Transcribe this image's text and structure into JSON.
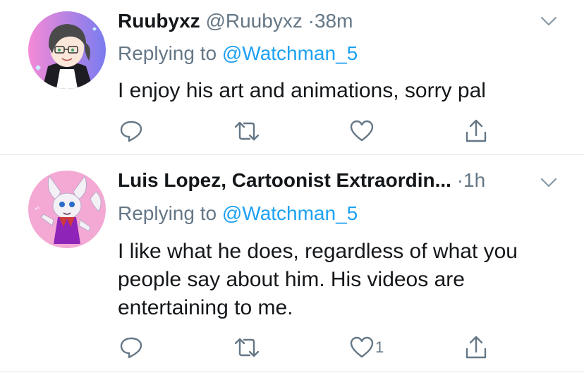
{
  "tweets": [
    {
      "display_name": "Ruubyxz",
      "handle": "@Ruubyxz",
      "separator": "·",
      "time": "38m",
      "replying_prefix": "Replying to",
      "replying_to": "@Watchman_5",
      "text": "I enjoy his art and animations, sorry pal",
      "like_count": "",
      "avatar_colors": {
        "bg_left": "#f58ad6",
        "bg_right": "#7a7cf0",
        "hair": "#4a4a4a",
        "skin": "#fbe6da"
      }
    },
    {
      "display_name": "Luis Lopez, Cartoonist Extraordin...",
      "handle": "",
      "separator": "·",
      "time": "1h",
      "replying_prefix": "Replying to",
      "replying_to": "@Watchman_5",
      "text": "I like what he does, regardless of what you people say about him. His videos are entertaining to me.",
      "like_count": "1",
      "avatar_colors": {
        "bg": "#f4a9d4",
        "fur": "#f3f1f6",
        "dress": "#8e24b8"
      }
    }
  ],
  "icons": {
    "reply": "reply-icon",
    "retweet": "retweet-icon",
    "like": "heart-icon",
    "share": "share-icon",
    "menu": "chevron-down-icon"
  },
  "colors": {
    "text": "#14171a",
    "secondary": "#657786",
    "link": "#1da1f2",
    "divider": "#e1e8ed"
  }
}
